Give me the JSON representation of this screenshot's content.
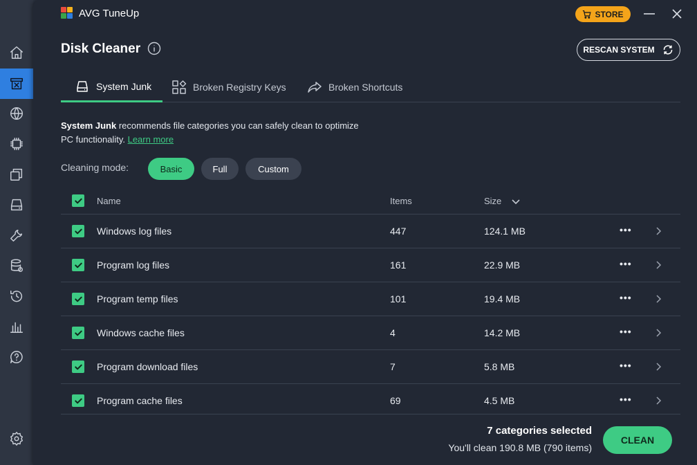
{
  "window": {
    "title": "AVG TuneUp",
    "store_label": "STORE"
  },
  "header": {
    "title": "Disk Cleaner",
    "rescan_label": "RESCAN SYSTEM"
  },
  "tabs": [
    {
      "label": "System Junk",
      "icon": "drive-icon",
      "active": true
    },
    {
      "label": "Broken Registry Keys",
      "icon": "registry-icon",
      "active": false
    },
    {
      "label": "Broken Shortcuts",
      "icon": "shortcut-arrow-icon",
      "active": false
    }
  ],
  "description": {
    "bold": "System Junk",
    "text": " recommends file categories you can safely clean to optimize PC functionality.",
    "link": "Learn more"
  },
  "cleaning_mode": {
    "label": "Cleaning mode:",
    "options": [
      "Basic",
      "Full",
      "Custom"
    ],
    "selected": "Basic"
  },
  "table": {
    "columns": {
      "name": "Name",
      "items": "Items",
      "size": "Size"
    },
    "rows": [
      {
        "name": "Windows log files",
        "items": "447",
        "size": "124.1 MB",
        "checked": true
      },
      {
        "name": "Program log files",
        "items": "161",
        "size": "22.9 MB",
        "checked": true
      },
      {
        "name": "Program temp files",
        "items": "101",
        "size": "19.4 MB",
        "checked": true
      },
      {
        "name": "Windows cache files",
        "items": "4",
        "size": "14.2 MB",
        "checked": true
      },
      {
        "name": "Program download files",
        "items": "7",
        "size": "5.8 MB",
        "checked": true
      },
      {
        "name": "Program cache files",
        "items": "69",
        "size": "4.5 MB",
        "checked": true
      }
    ]
  },
  "footer": {
    "selected_text": "7 categories selected",
    "summary_text": "You'll clean 190.8 MB (790 items)",
    "clean_label": "CLEAN"
  },
  "sidebar": {
    "items": [
      {
        "icon": "home-icon"
      },
      {
        "icon": "disk-cleaner-icon",
        "active": true
      },
      {
        "icon": "globe-icon"
      },
      {
        "icon": "chip-icon"
      },
      {
        "icon": "windows-stack-icon"
      },
      {
        "icon": "drive-icon"
      },
      {
        "icon": "wrench-icon"
      },
      {
        "icon": "database-icon"
      },
      {
        "icon": "history-icon"
      },
      {
        "icon": "chart-icon"
      },
      {
        "icon": "help-icon"
      },
      {
        "icon": "settings-icon"
      }
    ]
  },
  "colors": {
    "accent": "#3ecb84",
    "store": "#f4a41a",
    "active_sidebar": "#2f7fe0"
  }
}
